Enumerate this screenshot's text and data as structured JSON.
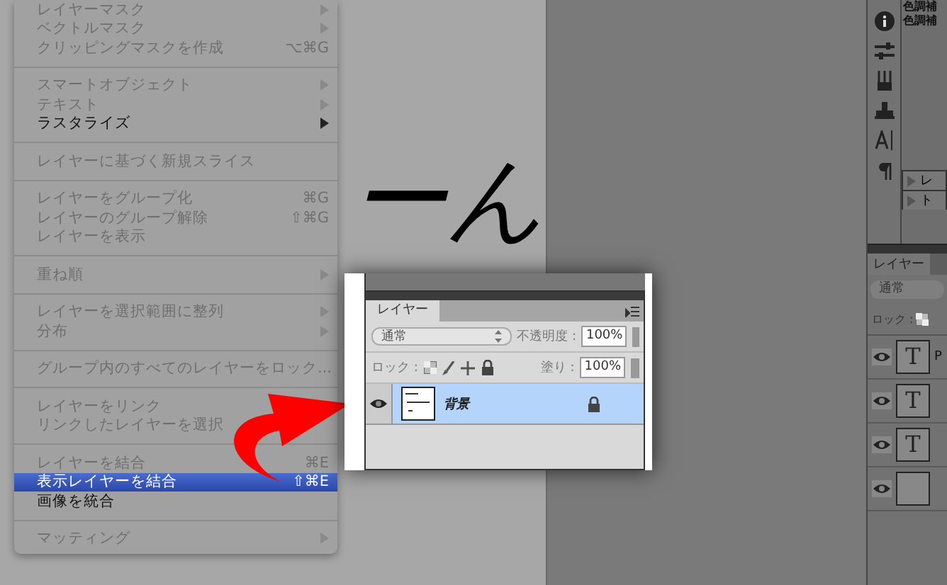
{
  "menu": {
    "items": [
      {
        "kind": "item",
        "label": "レイヤーマスク",
        "disabled": true,
        "submenu": true,
        "selected": false
      },
      {
        "kind": "item",
        "label": "ベクトルマスク",
        "disabled": true,
        "submenu": true,
        "selected": false
      },
      {
        "kind": "item",
        "label": "クリッピングマスクを作成",
        "disabled": true,
        "shortcut": "⌥⌘G",
        "selected": false
      },
      {
        "kind": "separator"
      },
      {
        "kind": "item",
        "label": "スマートオブジェクト",
        "disabled": true,
        "submenu": true,
        "selected": false
      },
      {
        "kind": "item",
        "label": "テキスト",
        "disabled": true,
        "submenu": true,
        "selected": false
      },
      {
        "kind": "item",
        "label": "ラスタライズ",
        "disabled": false,
        "submenu": true,
        "selected": false
      },
      {
        "kind": "separator"
      },
      {
        "kind": "item",
        "label": "レイヤーに基づく新規スライス",
        "disabled": true,
        "selected": false
      },
      {
        "kind": "separator"
      },
      {
        "kind": "item",
        "label": "レイヤーをグループ化",
        "disabled": true,
        "shortcut": "⌘G",
        "selected": false
      },
      {
        "kind": "item",
        "label": "レイヤーのグループ解除",
        "disabled": true,
        "shortcut": "⇧⌘G",
        "selected": false
      },
      {
        "kind": "item",
        "label": "レイヤーを表示",
        "disabled": true,
        "selected": false
      },
      {
        "kind": "separator"
      },
      {
        "kind": "item",
        "label": "重ね順",
        "disabled": true,
        "submenu": true,
        "selected": false
      },
      {
        "kind": "separator"
      },
      {
        "kind": "item",
        "label": "レイヤーを選択範囲に整列",
        "disabled": true,
        "submenu": true,
        "selected": false
      },
      {
        "kind": "item",
        "label": "分布",
        "disabled": true,
        "submenu": true,
        "selected": false
      },
      {
        "kind": "separator"
      },
      {
        "kind": "item",
        "label": "グループ内のすべてのレイヤーをロック...",
        "disabled": true,
        "selected": false
      },
      {
        "kind": "separator"
      },
      {
        "kind": "item",
        "label": "レイヤーをリンク",
        "disabled": true,
        "selected": false
      },
      {
        "kind": "item",
        "label": "リンクしたレイヤーを選択",
        "disabled": true,
        "selected": false
      },
      {
        "kind": "separator"
      },
      {
        "kind": "item",
        "label": "レイヤーを結合",
        "disabled": true,
        "shortcut": "⌘E",
        "selected": false
      },
      {
        "kind": "item",
        "label": "表示レイヤーを結合",
        "disabled": false,
        "shortcut": "⇧⌘E",
        "selected": true
      },
      {
        "kind": "item",
        "label": "画像を統合",
        "disabled": false,
        "selected": false
      },
      {
        "kind": "separator"
      },
      {
        "kind": "item",
        "label": "マッティング",
        "disabled": true,
        "submenu": true,
        "selected": false
      }
    ]
  },
  "canvas": {
    "text": "ーん"
  },
  "layers_popup": {
    "tab": "レイヤー",
    "blend_mode": "通常",
    "opacity_label": "不透明度 :",
    "opacity": "100%",
    "lock_label": "ロック :",
    "fill_label": "塗り :",
    "fill": "100%",
    "layers": [
      {
        "name": "背景",
        "selected": true,
        "locked": true,
        "visible": true
      }
    ]
  },
  "right_panel": {
    "adjustments": [
      "色調補",
      "色調補"
    ],
    "groups": [
      "レ",
      "ト"
    ],
    "layers_panel": {
      "tab": "レイヤー",
      "blend_mode": "通常",
      "lock_label": "ロック :",
      "layers": [
        {
          "kind": "text",
          "thumb": "T",
          "name": "P"
        },
        {
          "kind": "text",
          "thumb": "T"
        },
        {
          "kind": "text",
          "thumb": "T"
        },
        {
          "kind": "fill"
        }
      ]
    }
  }
}
